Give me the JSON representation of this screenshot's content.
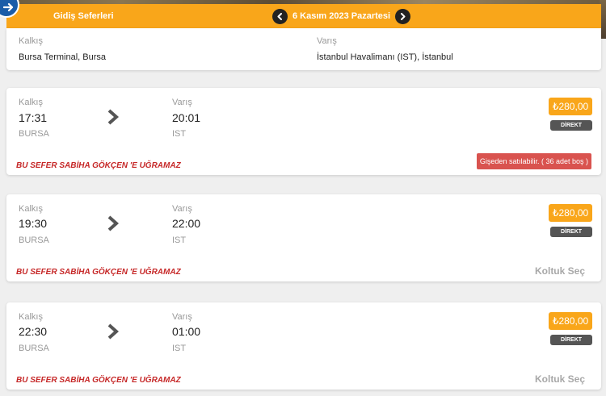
{
  "header": {
    "title": "Gidiş Seferleri",
    "date": "6 Kasım 2023 Pazartesi",
    "colors": {
      "accent": "#f9a61a",
      "nav": "#222222",
      "back": "#1a5ca8"
    }
  },
  "route": {
    "from_label": "Kalkış",
    "from_value": "Bursa Terminal, Bursa",
    "to_label": "Varış",
    "to_value": "İstanbul Havalimanı (IST), İstanbul"
  },
  "trips": [
    {
      "dep_label": "Kalkış",
      "dep_time": "17:31",
      "dep_code": "BURSA",
      "arr_label": "Varış",
      "arr_time": "20:01",
      "arr_code": "IST",
      "price": "₺280,00",
      "direct": "DİREKT",
      "warning": "BU SEFER SABİHA GÖKÇEN 'E UĞRAMAZ",
      "counter": "Gişeden satılabilir. ( 36 adet boş )"
    },
    {
      "dep_label": "Kalkış",
      "dep_time": "19:30",
      "dep_code": "BURSA",
      "arr_label": "Varış",
      "arr_time": "22:00",
      "arr_code": "IST",
      "price": "₺280,00",
      "direct": "DİREKT",
      "warning": "BU SEFER SABİHA GÖKÇEN 'E UĞRAMAZ",
      "seat": "Koltuk Seç"
    },
    {
      "dep_label": "Kalkış",
      "dep_time": "22:30",
      "dep_code": "BURSA",
      "arr_label": "Varış",
      "arr_time": "01:00",
      "arr_code": "IST",
      "price": "₺280,00",
      "direct": "DİREKT",
      "warning": "BU SEFER SABİHA GÖKÇEN 'E UĞRAMAZ",
      "seat": "Koltuk Seç"
    }
  ]
}
